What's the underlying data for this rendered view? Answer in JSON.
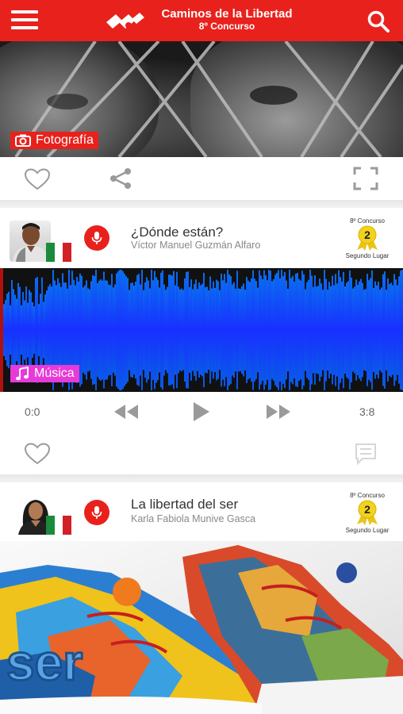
{
  "app": {
    "title": "Caminos de la Libertad",
    "subtitle": "8º Concurso",
    "accent_color": "#e8211c"
  },
  "header": {
    "menu_icon": "hamburger-menu-icon",
    "logo_icon": "caminos-logo-icon",
    "search_icon": "search-icon"
  },
  "posts": [
    {
      "category": "Fotografía",
      "category_icon": "camera-icon",
      "category_color": "#e8211c",
      "actions": [
        "heart-icon",
        "share-icon",
        "fullscreen-icon"
      ]
    },
    {
      "title": "¿Dónde están?",
      "author": "Víctor Manuel Guzmán Alfaro",
      "badge_top": "8º Concurso",
      "badge_place": "2",
      "badge_bottom": "Segundo Lugar",
      "category": "Música",
      "category_icon": "music-note-icon",
      "category_color": "#e83ad8",
      "player": {
        "current_time": "0:0",
        "total_time": "3:8",
        "controls": [
          "rewind-icon",
          "play-icon",
          "fast-forward-icon"
        ]
      },
      "actions": [
        "heart-icon",
        "comment-icon"
      ]
    },
    {
      "title": "La libertad del ser",
      "author": "Karla Fabiola Munive Gasca",
      "badge_top": "8º Concurso",
      "badge_place": "2",
      "badge_bottom": "Segundo Lugar",
      "image_text": "ser"
    }
  ]
}
